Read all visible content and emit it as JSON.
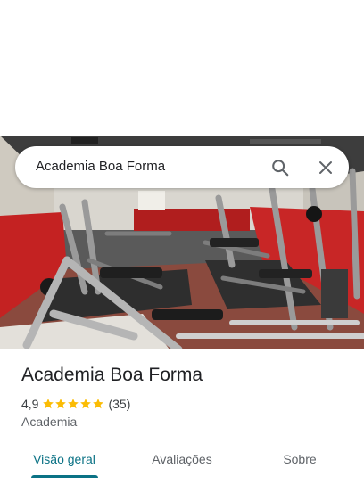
{
  "search": {
    "query": "Academia Boa Forma",
    "search_icon": "search-icon",
    "close_icon": "close-icon"
  },
  "photo": {
    "subject": "gym-interior-photo"
  },
  "place": {
    "name": "Academia Boa Forma",
    "rating": "4,9",
    "stars": 5,
    "reviews_count": "(35)",
    "category": "Academia"
  },
  "tabs": [
    {
      "label": "Visão geral",
      "active": true
    },
    {
      "label": "Avaliações",
      "active": false
    },
    {
      "label": "Sobre",
      "active": false
    }
  ],
  "colors": {
    "accent": "#0b7285",
    "star": "#fbbc04"
  }
}
